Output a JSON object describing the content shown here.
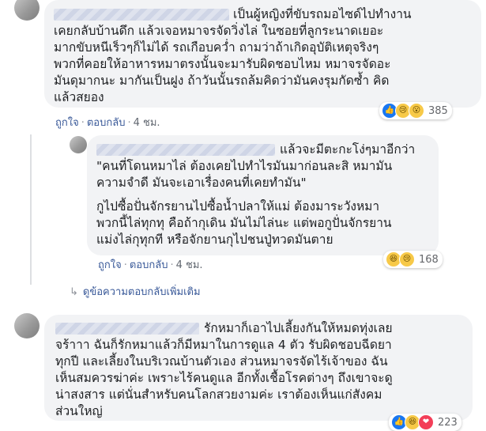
{
  "comments": [
    {
      "id": "c1",
      "text_lines": [
        "เป็นผู้หญิงที่ขับรถมอไซด์ไปทำงาน",
        "เคยกลับบ้านดึก แล้วเจอหมาจรจัดวิ่งไล่ ในซอยที่ลูกระนาดเยอะ",
        "มากขับหนีเร็วๆก็ไม่ได้ รถเกือบคว่ำ ถามว่าถ้าเกิดอุบัติเหตุจริงๆ",
        "พวกที่คอยให้อาหารหมาตรงนั้นจะมารับผิดชอบไหม หมาจรจัดอะ",
        "มันดุมากนะ มากันเป็นฝูง ถ้าวันนั้นรถล้มคิดว่ามันคงรุมกัดซ้ำ คิด",
        "แล้วสยอง"
      ],
      "reactions": {
        "icons": [
          "like-icon",
          "sad-icon",
          "wow-icon"
        ],
        "count": "385"
      },
      "actions": {
        "like": "ถูกใจ",
        "reply": "ตอบกลับ",
        "time": "4 ชม."
      }
    },
    {
      "id": "c2",
      "text_lines": [
        "แล้วจะมีตะกะโง่ๆมาอีกว่า",
        "\"คนที่โดนหมาไล่ ต้องเคยไปทำไรมันมาก่อนละสิ หมามัน",
        "ความจำดี มันจะเอาเรื่องคนที่เคยทำมัน\"",
        "",
        "กูไปซื้อปั่นจักรยานไปซื้อน้ำปลาให้แม่ ต้องมาระวังหมา",
        "พวกนี้ไล่ทุกทุ คือถ้ากุเดิน มันไม่ไล่นะ แต่พอกูปั่นจักรยาน",
        "แม่งไล่กุทุกที หรือจักยานกุไปชนปู่ทวดมันตาย"
      ],
      "reactions": {
        "icons": [
          "haha-icon",
          "sad-icon"
        ],
        "count": "168"
      },
      "actions": {
        "like": "ถูกใจ",
        "reply": "ตอบกลับ",
        "time": "4 ชม."
      },
      "more_replies": "ดูข้อความตอบกลับเพิ่มเติม"
    },
    {
      "id": "c3",
      "text_lines": [
        "รักหมาก็เอาไปเลี้ยงกันให้หมดทุ่งเลย",
        "จร้าาา ฉันก็รักหมาแล้วก็มีหมาในการดูแล 4 ตัว รับผิดชอบฉีดยา",
        "ทุกปี และเลี้ยงในบริเวณบ้านตัวเอง ส่วนหมาจรจัดไร้เจ้าของ ฉัน",
        "เห็นสมควรฆ่าค่ะ เพราะไร้คนดูแล อีกทั้งเชื้อโรคต่างๆ ถึงเขาจะดู",
        "น่าสงสาร แต่นั่นสำหรับคนโลกสวยงามค่ะ เราต้องเห็นแก่สังคม",
        "ส่วนใหญ่"
      ],
      "reactions": {
        "icons": [
          "like-icon",
          "haha-icon",
          "love-icon"
        ],
        "count": "223"
      },
      "actions": {
        "like": "ถูกใจ",
        "reply": "ตอบกลับ",
        "time": "4 ชม."
      }
    }
  ]
}
